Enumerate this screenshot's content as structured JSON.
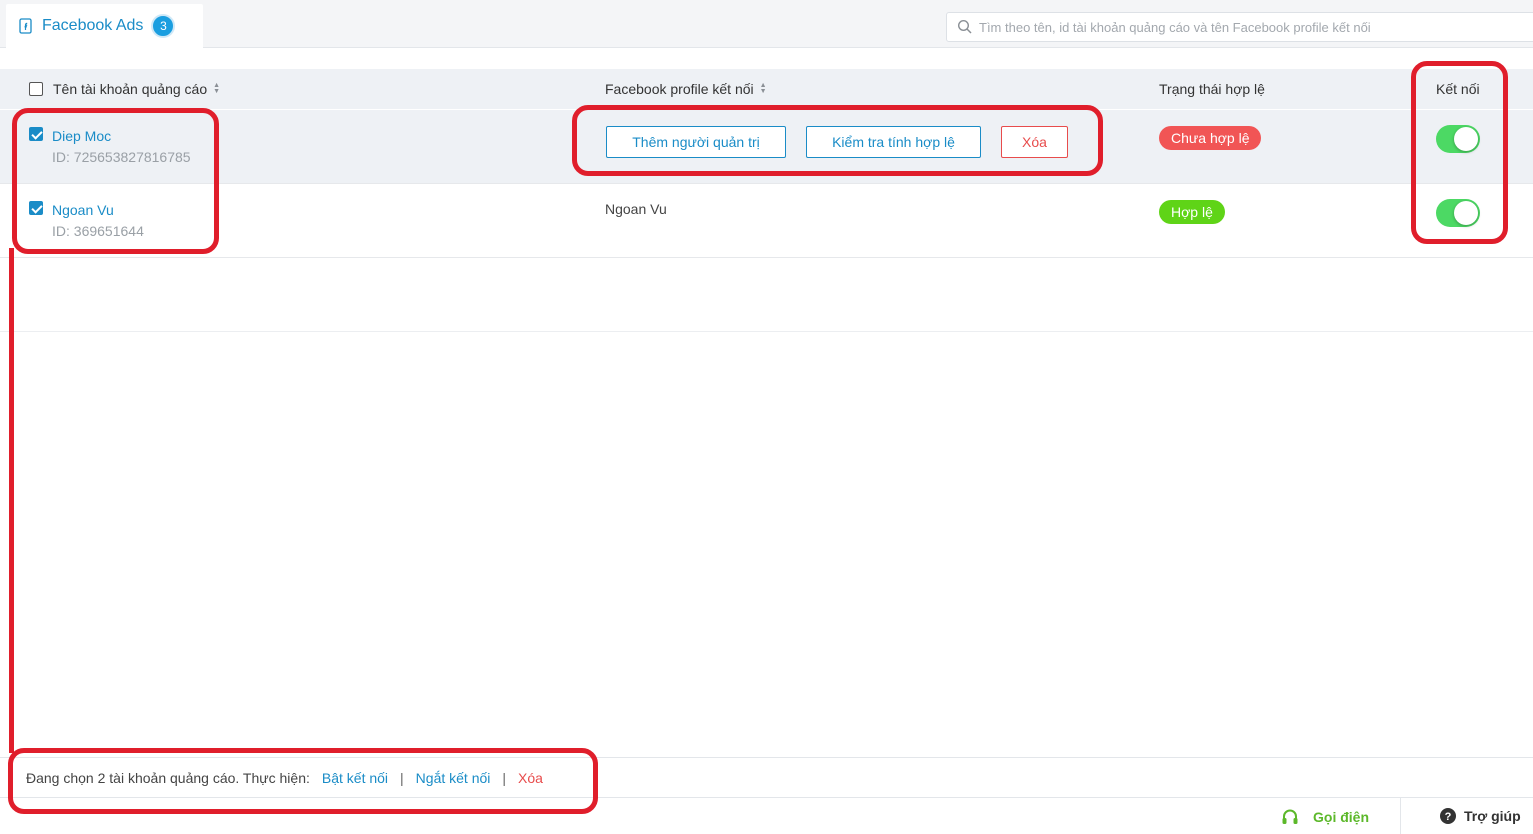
{
  "tab": {
    "label": "Facebook Ads",
    "count": "3"
  },
  "search": {
    "placeholder": "Tìm theo tên, id tài khoản quảng cáo và tên Facebook profile kết nối"
  },
  "table": {
    "headers": {
      "account": "Tên tài khoản quảng cáo",
      "profile": "Facebook profile kết nối",
      "status": "Trạng thái hợp lệ",
      "connect": "Kết nối"
    },
    "rows": [
      {
        "name": "Diep Moc",
        "id": "ID: 725653827816785",
        "checked": true,
        "actions": {
          "add_admin": "Thêm người quản trị",
          "check_valid": "Kiểm tra tính hợp lệ",
          "delete": "Xóa"
        },
        "status": "Chưa hợp lệ",
        "connected": true
      },
      {
        "name": "Ngoan Vu",
        "id": "ID: 369651644",
        "checked": true,
        "profile": "Ngoan Vu",
        "status": "Hợp lệ",
        "connected": true
      }
    ]
  },
  "selection_bar": {
    "text": "Đang chọn 2 tài khoản quảng cáo. Thực hiện:",
    "enable": "Bật kết nối",
    "disable": "Ngắt kết nối",
    "delete": "Xóa",
    "separator": "|"
  },
  "support": {
    "call": "Gọi điện",
    "help": "Trợ giúp"
  },
  "colors": {
    "accent": "#1a8cc7",
    "danger": "#e84c4c",
    "valid": "#5fd417",
    "toggle_on": "#4cd964",
    "annotation": "#e01e2b"
  }
}
